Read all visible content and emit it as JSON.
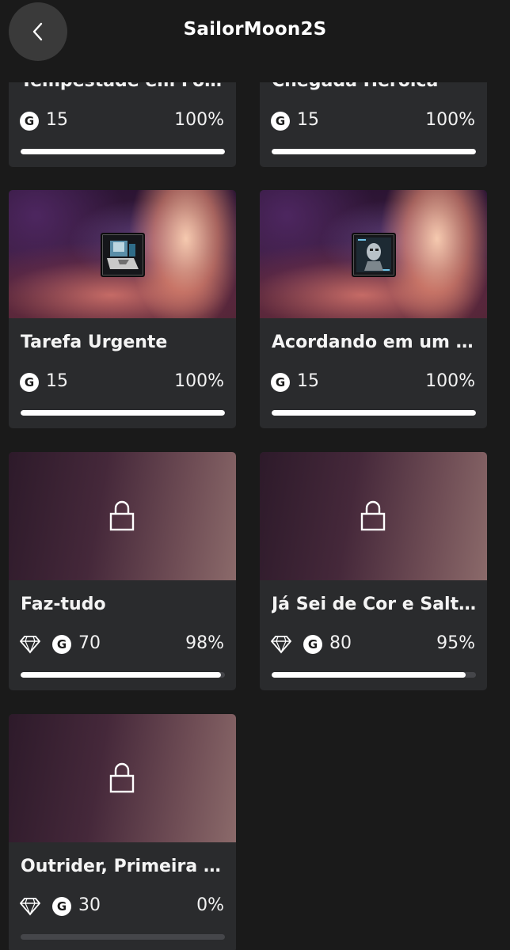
{
  "header": {
    "title": "SailorMoon2S"
  },
  "cards": [
    {
      "title": "Tempestade em For…",
      "score": "15",
      "percent": "100%",
      "progress": 1.0,
      "rare": false,
      "locked": false
    },
    {
      "title": "Chegada Heróica",
      "score": "15",
      "percent": "100%",
      "progress": 1.0,
      "rare": false,
      "locked": false
    },
    {
      "title": "Tarefa Urgente",
      "score": "15",
      "percent": "100%",
      "progress": 1.0,
      "rare": false,
      "locked": false
    },
    {
      "title": "Acordando em um P…",
      "score": "15",
      "percent": "100%",
      "progress": 1.0,
      "rare": false,
      "locked": false
    },
    {
      "title": "Faz-tudo",
      "score": "70",
      "percent": "98%",
      "progress": 0.98,
      "rare": true,
      "locked": true
    },
    {
      "title": "Já Sei de Cor e Salte…",
      "score": "80",
      "percent": "95%",
      "progress": 0.95,
      "rare": true,
      "locked": true
    },
    {
      "title": "Outrider, Primeira Cl…",
      "score": "30",
      "percent": "0%",
      "progress": 0.0,
      "rare": true,
      "locked": true
    }
  ],
  "gamerscore_badge": "G",
  "icons": {
    "back": "chevron-left-icon",
    "lock": "lock-icon",
    "gem": "diamond-icon",
    "gamerscore": "gamerscore-icon"
  },
  "colors": {
    "background": "#1a1a1a",
    "card": "#2a2b2d",
    "progress_fill": "#ffffff",
    "progress_track": "#45464a"
  }
}
